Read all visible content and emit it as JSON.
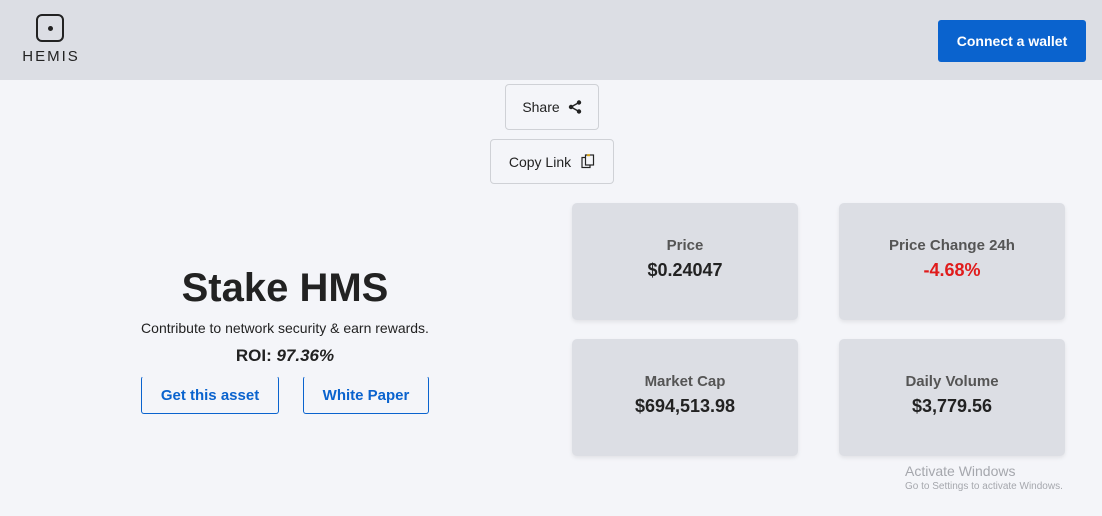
{
  "header": {
    "logo_text": "HEMIS",
    "connect_label": "Connect a wallet"
  },
  "share": {
    "share_label": "Share",
    "copy_label": "Copy Link"
  },
  "hero": {
    "title": "Stake HMS",
    "subtitle": "Contribute to network security & earn rewards.",
    "roi_label": "ROI:",
    "roi_value": "97.36%",
    "get_asset_label": "Get this asset",
    "white_paper_label": "White Paper"
  },
  "stats": {
    "price": {
      "label": "Price",
      "value": "$0.24047"
    },
    "price_change": {
      "label": "Price Change 24h",
      "value": "-4.68%"
    },
    "market_cap": {
      "label": "Market Cap",
      "value": "$694,513.98"
    },
    "daily_volume": {
      "label": "Daily Volume",
      "value": "$3,779.56"
    }
  },
  "watermark": {
    "title": "Activate Windows",
    "subtitle": "Go to Settings to activate Windows."
  },
  "colors": {
    "header_bg": "#dcdee4",
    "page_bg": "#f4f5f9",
    "accent": "#0a63ce",
    "negative": "#e01b1b",
    "card_bg": "#dcdee4"
  },
  "icons": [
    "hemis-logo-icon",
    "share-icon",
    "copy-icon"
  ]
}
